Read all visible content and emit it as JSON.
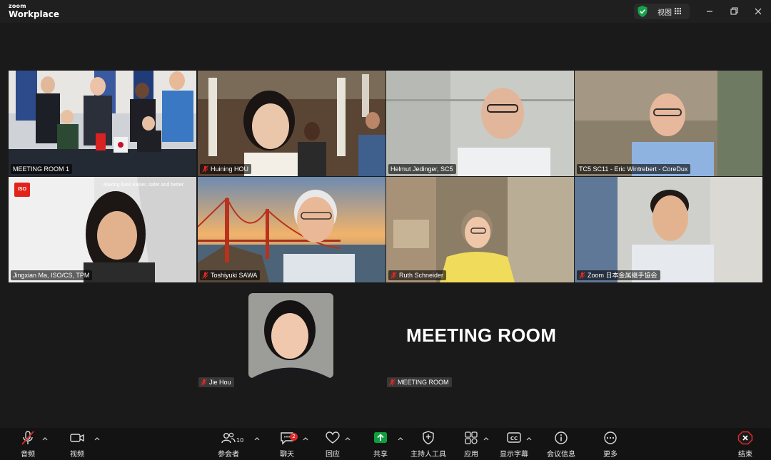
{
  "app": {
    "logo_top": "zoom",
    "logo_bottom": "Workplace",
    "view_label": "视图"
  },
  "participants": [
    {
      "name": "MEETING ROOM 1",
      "muted": false,
      "active": true
    },
    {
      "name": "Huining HOU",
      "muted": true
    },
    {
      "name": "Helmut Jedinger, SC5",
      "muted": false
    },
    {
      "name": "TC5 SC11 - Eric Wintrebert - CoreDux",
      "muted": false
    },
    {
      "name": "Jingxian Ma, ISO/CS, TPM",
      "muted": false,
      "logo": "ISO",
      "banner": "Making lives easier, safer and better"
    },
    {
      "name": "Toshiyuki SAWA",
      "muted": true
    },
    {
      "name": "Ruth Schneider",
      "muted": true
    },
    {
      "name": "Zoom 日本金属継手協会",
      "muted": true
    }
  ],
  "standalone": {
    "jie": {
      "name": "Jie Hou",
      "muted": true
    },
    "room": {
      "name": "MEETING ROOM",
      "muted": true,
      "title": "MEETING ROOM"
    }
  },
  "toolbar": {
    "audio": "音频",
    "video": "视频",
    "participants": "参会者",
    "participants_count": "10",
    "chat": "聊天",
    "chat_badge": "2",
    "reactions": "回应",
    "share": "共享",
    "host_tools": "主持人工具",
    "apps": "应用",
    "captions": "显示字幕",
    "meeting_info": "会议信息",
    "more": "更多",
    "end": "结束"
  },
  "colors": {
    "active_border": "#23d959",
    "share_green": "#0e9f3e",
    "end_red": "#e02828",
    "muted_red": "#e02828"
  }
}
